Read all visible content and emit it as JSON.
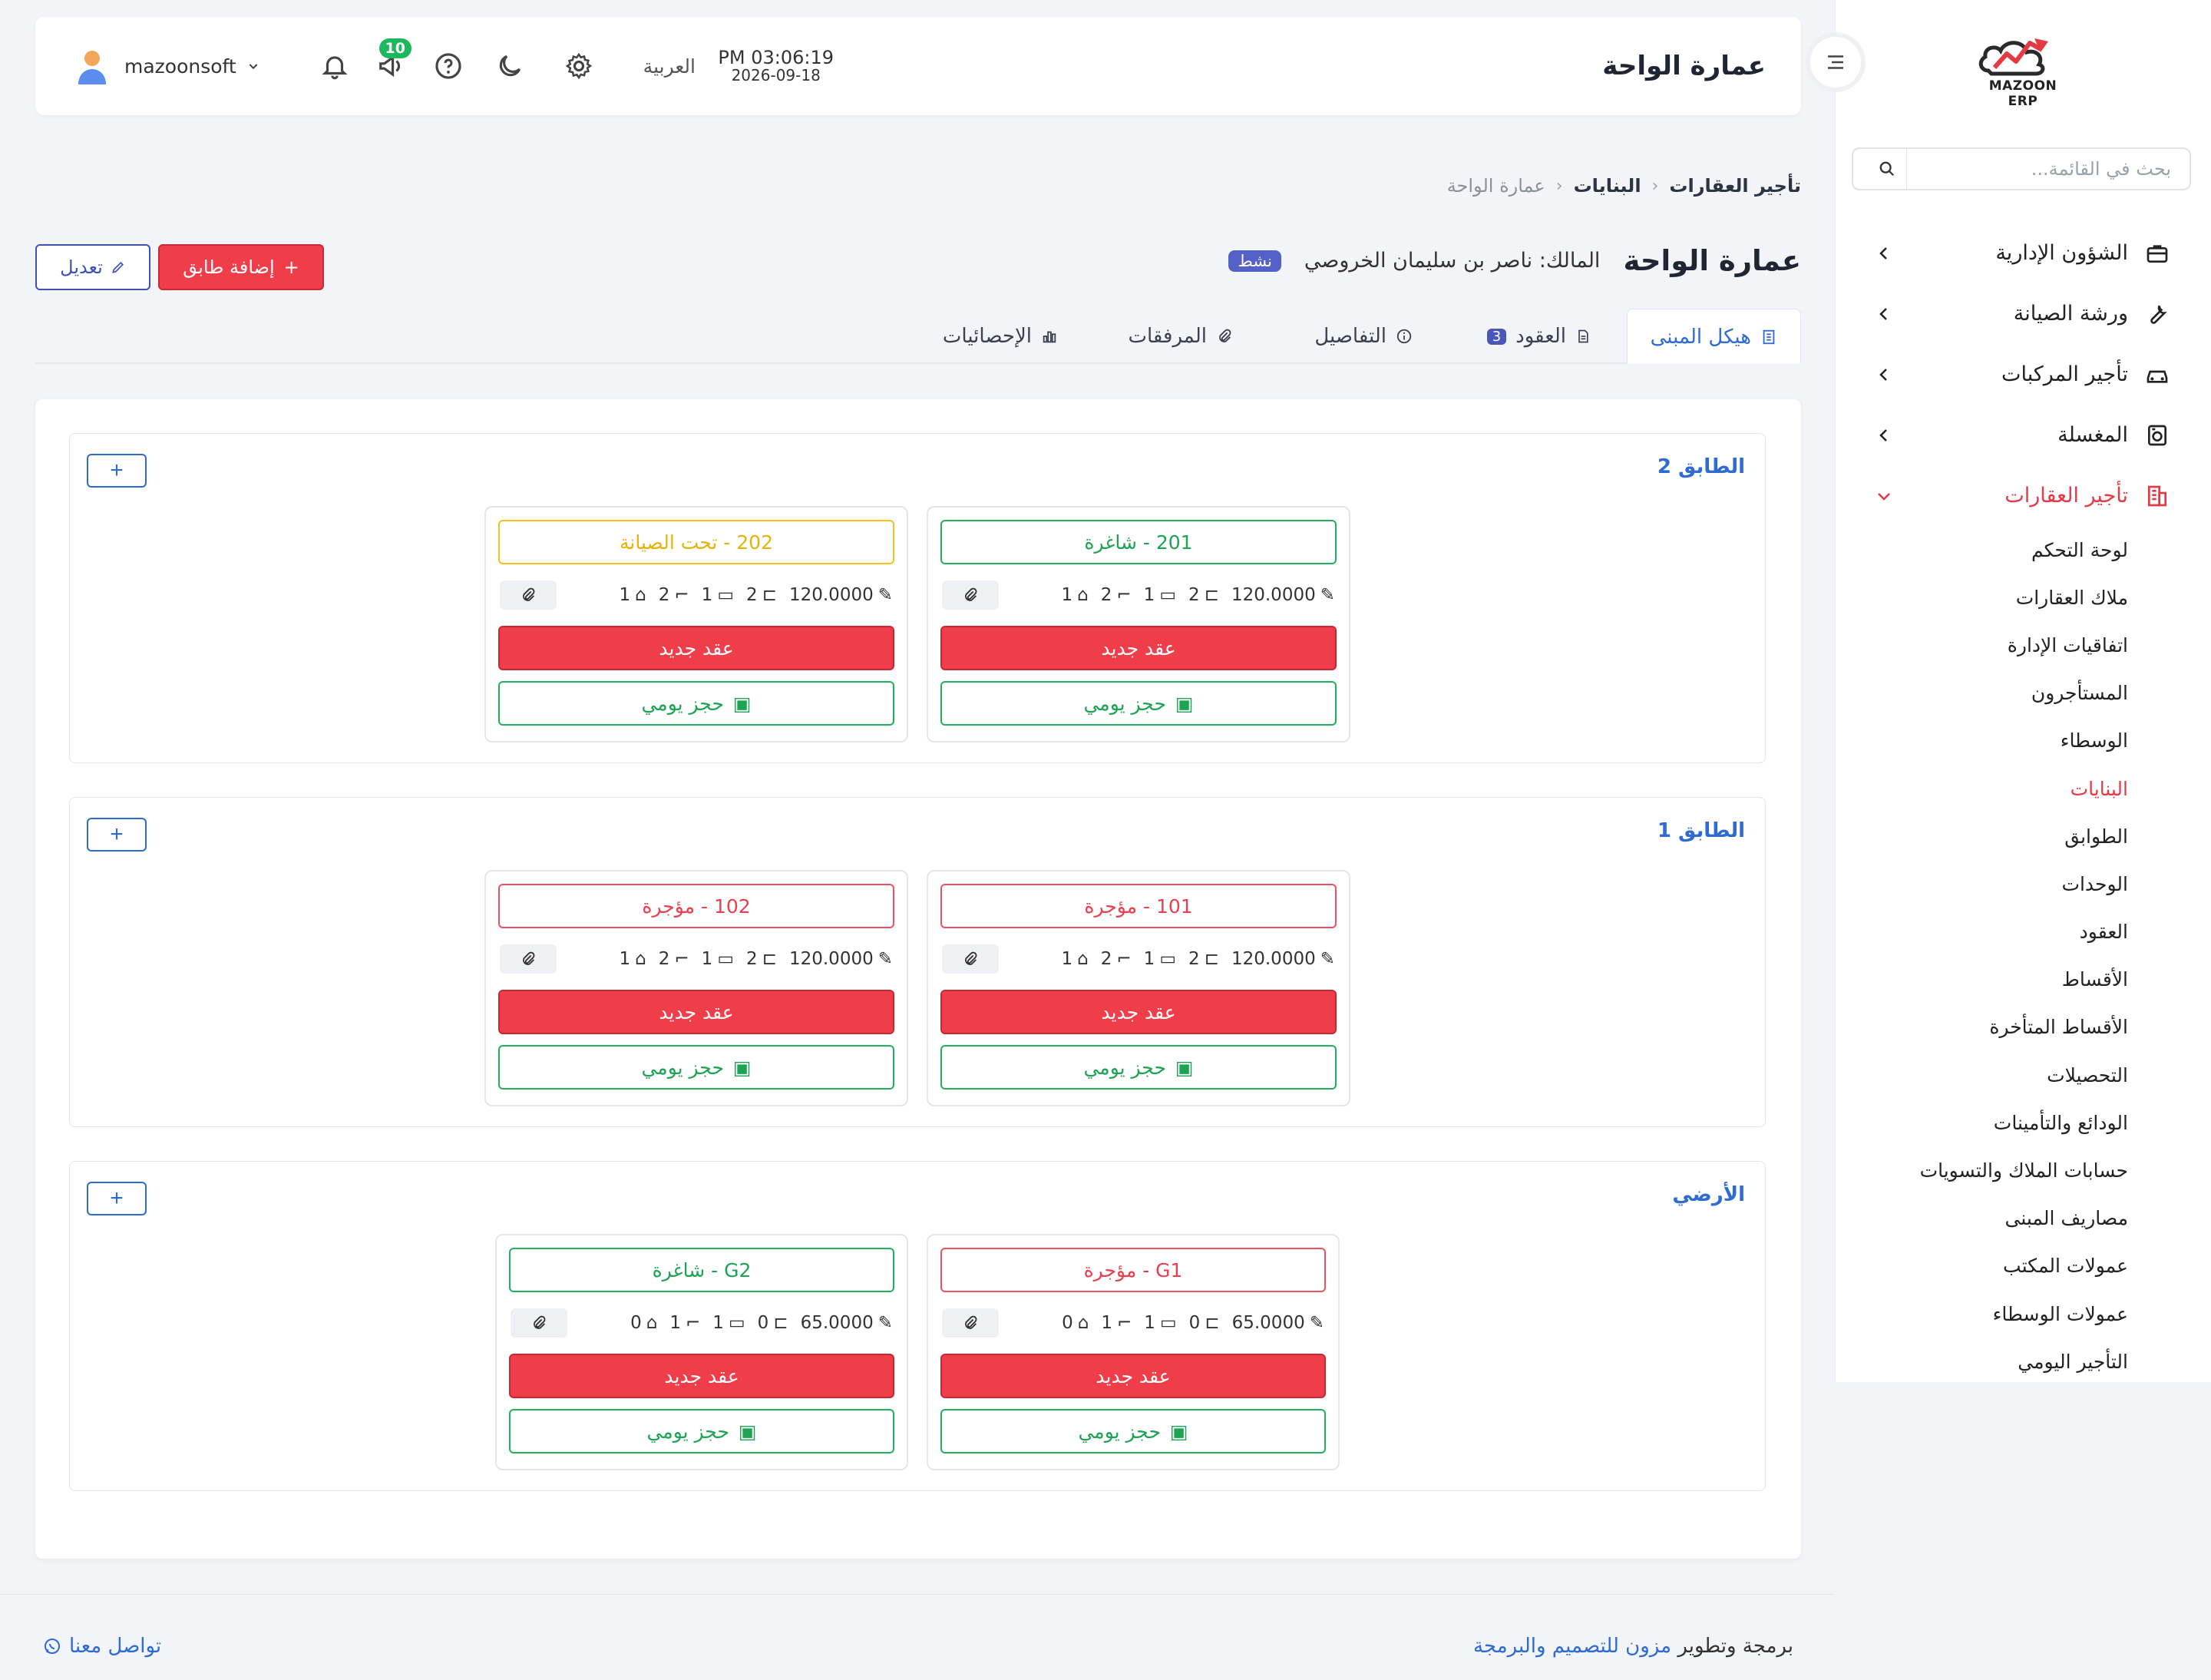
{
  "app": {
    "logo_text": "MAZOON ERP",
    "page_title": "عمارة الواحة",
    "time": "PM 03:06:19",
    "date": "2026-09-18",
    "language": "العربية",
    "notifications_count": "10",
    "username": "mazoonsoft"
  },
  "sidebar": {
    "search_placeholder": "بحث في القائمة...",
    "items": [
      {
        "label": "الشؤون الإدارية",
        "icon": "briefcase-icon"
      },
      {
        "label": "ورشة الصيانة",
        "icon": "wrench-icon"
      },
      {
        "label": "تأجير المركبات",
        "icon": "car-icon"
      },
      {
        "label": "المغسلة",
        "icon": "laundry-icon"
      },
      {
        "label": "تأجير العقارات",
        "icon": "building-icon",
        "active": true
      }
    ],
    "subitems": [
      "لوحة التحكم",
      "ملاك العقارات",
      "اتفاقيات الإدارة",
      "المستأجرون",
      "الوسطاء",
      "البنايات",
      "الطوابق",
      "الوحدات",
      "العقود",
      "الأقساط",
      "الأقساط المتأخرة",
      "التحصيلات",
      "الودائع والتأمينات",
      "حسابات الملاك والتسويات",
      "مصاريف المبنى",
      "عمولات المكتب",
      "عمولات الوسطاء",
      "التأجير اليومي"
    ],
    "active_subitem": "البنايات"
  },
  "breadcrumb": {
    "level1": "تأجير العقارات",
    "level2": "البنايات",
    "level3": "عمارة الواحة"
  },
  "building": {
    "title": "عمارة الواحة",
    "owner": "المالك: ناصر بن سليمان الخروصي",
    "status": "نشط",
    "add_floor_label": "إضافة طابق",
    "edit_label": "تعديل"
  },
  "tabs": [
    {
      "label": "هيكل المبنى",
      "active": true
    },
    {
      "label": "العقود",
      "count": "3"
    },
    {
      "label": "التفاصيل"
    },
    {
      "label": "المرفقات"
    },
    {
      "label": "الإحصائيات"
    }
  ],
  "floors": [
    {
      "title": "الطابق 2",
      "units": [
        {
          "status": "201 - شاغرة",
          "color": "green",
          "price": "120.0000",
          "bedrooms": "2",
          "living": "1",
          "baths": "2",
          "kitchens": "1"
        },
        {
          "status": "202 - تحت الصيانة",
          "color": "yellow",
          "price": "120.0000",
          "bedrooms": "2",
          "living": "1",
          "baths": "2",
          "kitchens": "1"
        }
      ]
    },
    {
      "title": "الطابق 1",
      "units": [
        {
          "status": "101 - مؤجرة",
          "color": "red",
          "price": "120.0000",
          "bedrooms": "2",
          "living": "1",
          "baths": "2",
          "kitchens": "1"
        },
        {
          "status": "102 - مؤجرة",
          "color": "red",
          "price": "120.0000",
          "bedrooms": "2",
          "living": "1",
          "baths": "2",
          "kitchens": "1"
        }
      ]
    },
    {
      "title": "الأرضي",
      "units": [
        {
          "status": "G1 - مؤجرة",
          "color": "red",
          "price": "65.0000",
          "bedrooms": "0",
          "living": "1",
          "baths": "1",
          "kitchens": "0"
        },
        {
          "status": "G2 - شاغرة",
          "color": "green",
          "price": "65.0000",
          "bedrooms": "0",
          "living": "1",
          "baths": "1",
          "kitchens": "0"
        }
      ]
    }
  ],
  "unit_actions": {
    "new_contract": "عقد جديد",
    "daily_booking": "حجز يومي",
    "add_unit": "+"
  },
  "footer": {
    "credit_prefix": "برمجة وتطوير",
    "credit_link": "مزون للتصميم والبرمجة",
    "contact": "تواصل معنا"
  },
  "colors": {
    "accent": "#2f6bd1",
    "danger": "#ef3e4a",
    "success": "#22b15b",
    "warning": "#f3c21b",
    "status_pill": "#5561c6"
  }
}
